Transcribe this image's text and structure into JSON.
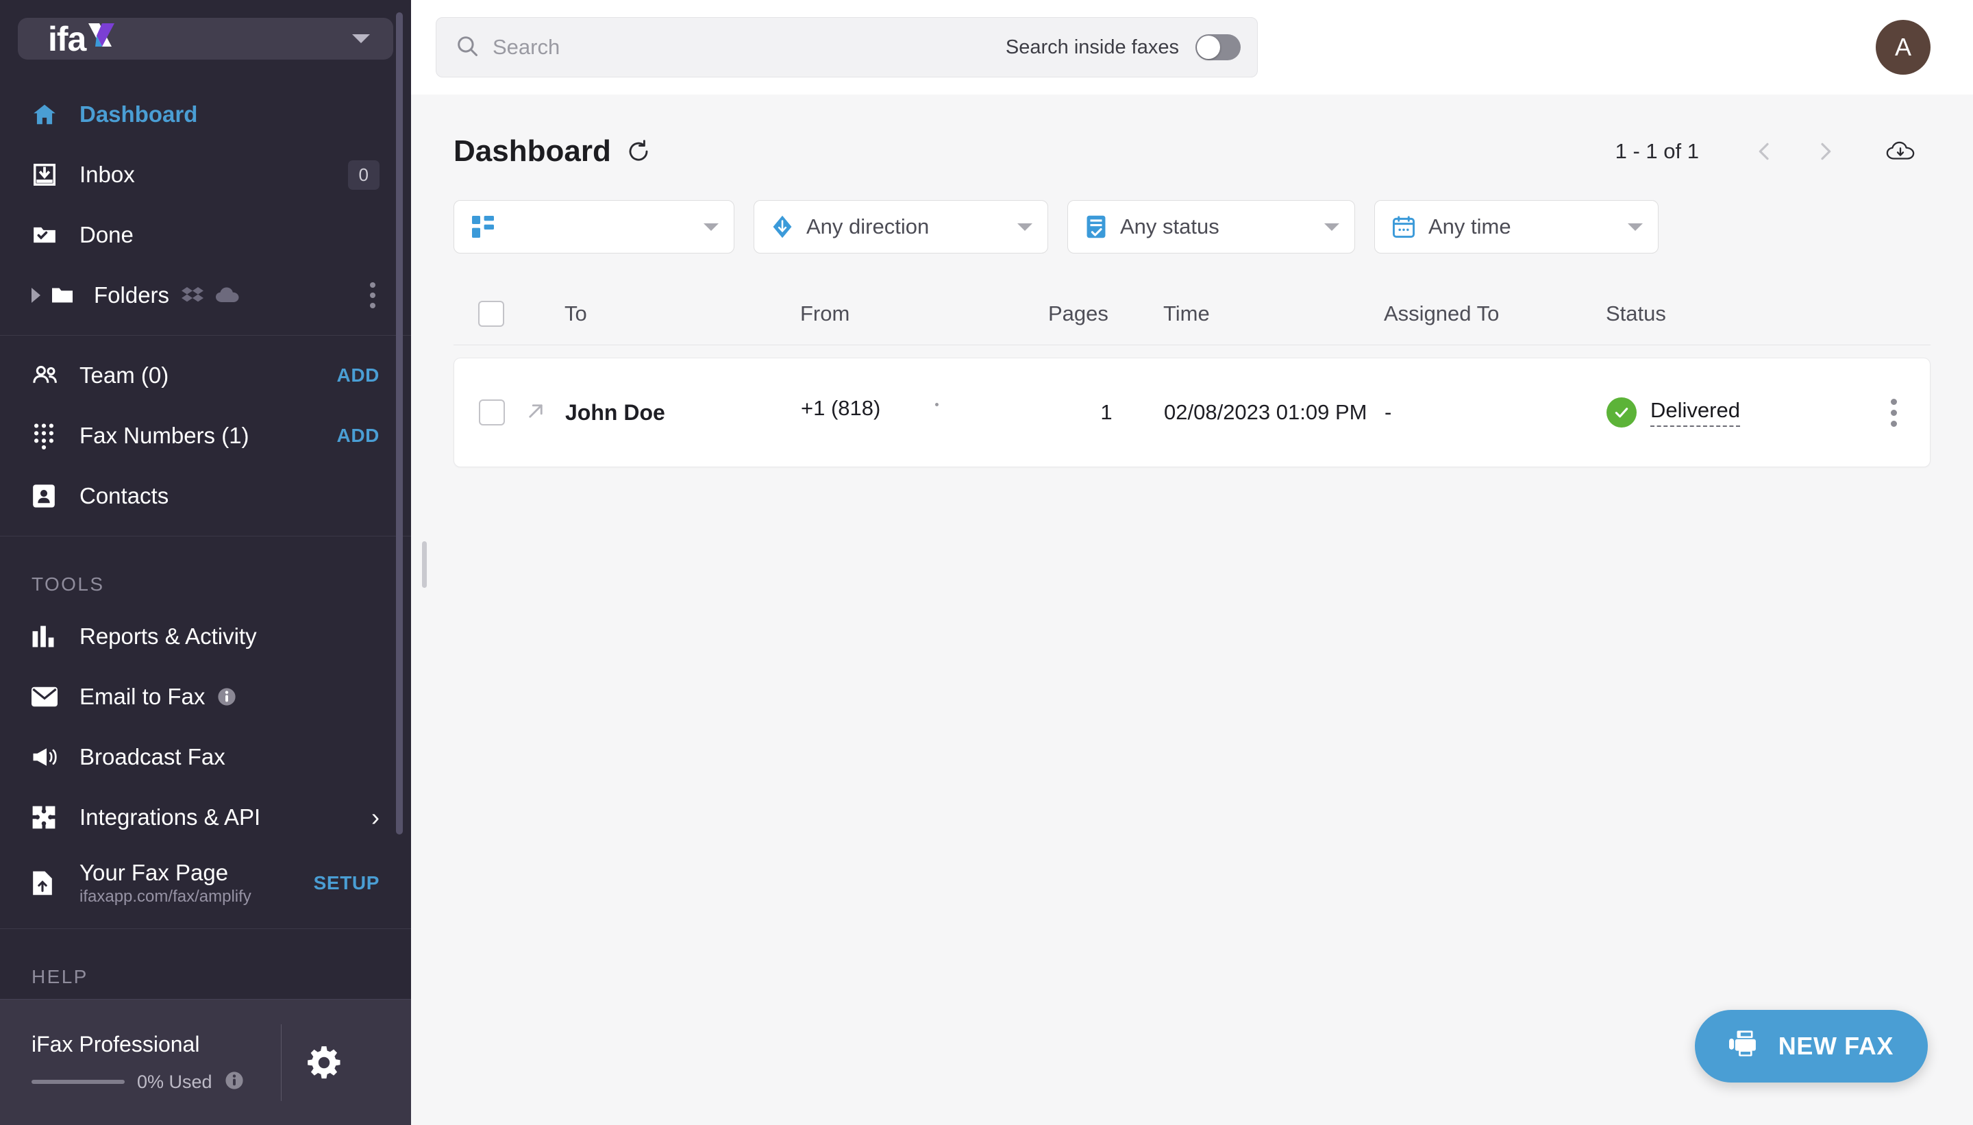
{
  "brand": {
    "logo_text": "ifa",
    "logo_accent_letter": "x",
    "accent_color": "#4a9ed4",
    "purple": "#7b3fd4"
  },
  "sidebar": {
    "nav": [
      {
        "label": "Dashboard",
        "icon": "home-icon",
        "active": true
      },
      {
        "label": "Inbox",
        "icon": "inbox-icon",
        "badge": "0"
      },
      {
        "label": "Done",
        "icon": "folder-check-icon"
      },
      {
        "label": "Folders",
        "icon": "folder-icon",
        "extra_icons": [
          "dropbox-icon",
          "cloud-icon"
        ],
        "menu": "more-icon"
      }
    ],
    "accounts": [
      {
        "label": "Team (0)",
        "icon": "team-icon",
        "action": "ADD"
      },
      {
        "label": "Fax Numbers (1)",
        "icon": "keypad-icon",
        "action": "ADD"
      },
      {
        "label": "Contacts",
        "icon": "contacts-icon"
      }
    ],
    "tools_title": "TOOLS",
    "tools": [
      {
        "label": "Reports & Activity",
        "icon": "bar-chart-icon"
      },
      {
        "label": "Email to Fax",
        "icon": "envelope-icon",
        "info": true
      },
      {
        "label": "Broadcast Fax",
        "icon": "megaphone-icon"
      },
      {
        "label": "Integrations & API",
        "icon": "puzzle-icon",
        "chevron": true
      },
      {
        "label": "Your Fax Page",
        "sub": "ifaxapp.com/fax/amplify",
        "icon": "file-upload-icon",
        "action": "SETUP"
      }
    ],
    "help_title": "HELP",
    "footer": {
      "plan": "iFax Professional",
      "usage": "0% Used",
      "usage_percent": 0,
      "settings_icon": "gear-icon"
    }
  },
  "topbar": {
    "search_placeholder": "Search",
    "search_value": "",
    "search_icon": "search-icon",
    "toggle_label": "Search inside faxes",
    "toggle_on": false,
    "avatar_initial": "A"
  },
  "page": {
    "title": "Dashboard",
    "refresh_icon": "refresh-icon",
    "pagination": "1 - 1 of 1",
    "prev_icon": "chevron-left-icon",
    "next_icon": "chevron-right-icon",
    "download_icon": "cloud-download-icon"
  },
  "filters": [
    {
      "label": "",
      "icon": "grid-icon"
    },
    {
      "label": "Any direction",
      "icon": "direction-icon"
    },
    {
      "label": "Any status",
      "icon": "status-icon"
    },
    {
      "label": "Any time",
      "icon": "calendar-icon"
    }
  ],
  "table": {
    "columns": [
      "To",
      "From",
      "Pages",
      "Time",
      "Assigned To",
      "Status"
    ],
    "rows": [
      {
        "direction_icon": "outgoing-arrow-icon",
        "to": "John Doe",
        "from": "+1 (818)",
        "pages": "1",
        "time": "02/08/2023 01:09 PM",
        "assigned_to": "-",
        "status": "Delivered",
        "status_color": "#5cb338",
        "menu_icon": "more-icon"
      }
    ]
  },
  "new_fax_button": {
    "label": "NEW FAX",
    "icon": "fax-machine-icon"
  }
}
